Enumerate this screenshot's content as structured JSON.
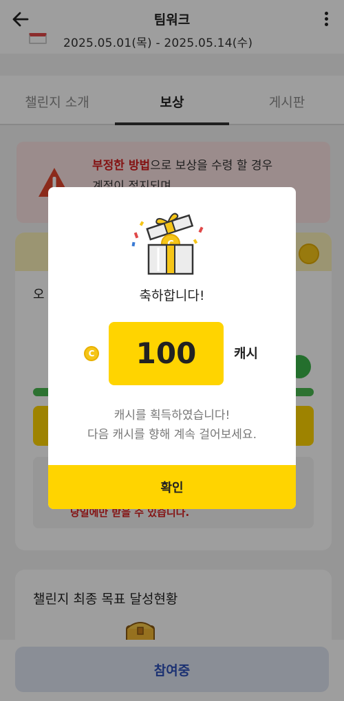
{
  "header": {
    "title": "팀워크"
  },
  "period": {
    "text": "2025.05.01(목) - 2025.05.14(수)"
  },
  "tabs": [
    {
      "label": "챌린지 소개"
    },
    {
      "label": "보상"
    },
    {
      "label": "게시판"
    }
  ],
  "warning": {
    "emphasis": "부정한 방법",
    "line1_rest": "으로 보상을 수령 할 경우",
    "line2": "계정이 정지되며,"
  },
  "reward": {
    "label": "오",
    "note": "당일에만 받을 수 있습니다.",
    "progress": 1.0
  },
  "goal": {
    "title": "챌린지 최종 목표 달성현황"
  },
  "join": {
    "label": "참여중"
  },
  "dialog": {
    "title": "축하합니다!",
    "coin_symbol": "C",
    "amount": "100",
    "unit": "캐시",
    "message_line1": "캐시를 획득하였습니다!",
    "message_line2": "다음 캐시를 향해 계속 걸어보세요.",
    "confirm": "확인"
  },
  "colors": {
    "accent_yellow": "#ffd400",
    "warning_red": "#d62020",
    "join_text": "#2d4fb8"
  }
}
